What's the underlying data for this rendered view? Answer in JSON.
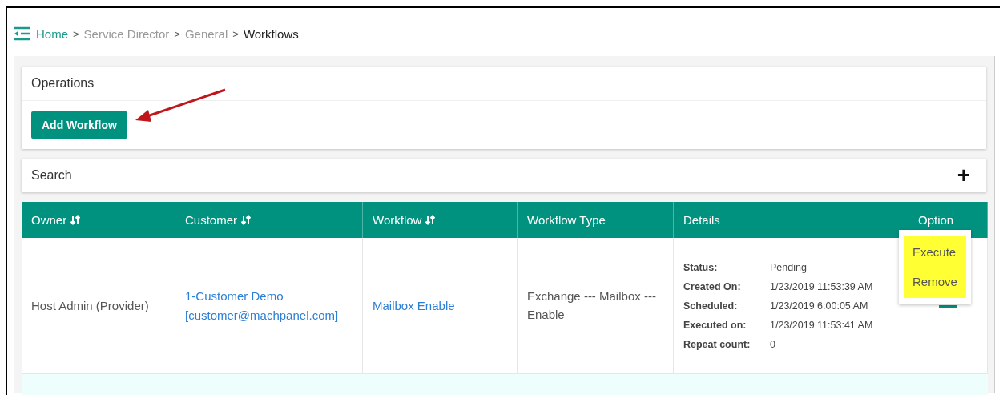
{
  "breadcrumb": [
    {
      "label": "Home",
      "kind": "link"
    },
    {
      "label": "Service Director",
      "kind": "muted"
    },
    {
      "label": "General",
      "kind": "muted"
    },
    {
      "label": "Workflows",
      "kind": "current"
    }
  ],
  "breadcrumb_separator": ">",
  "operations": {
    "title": "Operations",
    "button": "Add Workflow"
  },
  "search": {
    "title": "Search",
    "toggle": "+"
  },
  "table": {
    "columns": [
      {
        "label": "Owner",
        "sortable": true
      },
      {
        "label": "Customer",
        "sortable": true
      },
      {
        "label": "Workflow",
        "sortable": true
      },
      {
        "label": "Workflow Type",
        "sortable": false
      },
      {
        "label": "Details",
        "sortable": false
      },
      {
        "label": "Option",
        "sortable": false
      }
    ],
    "rows": [
      {
        "owner": "Host Admin (Provider)",
        "customer": [
          "1-Customer Demo",
          "[customer@machpanel.com]"
        ],
        "workflow": "Mailbox Enable",
        "workflow_type": "Exchange --- Mailbox --- Enable",
        "details": [
          {
            "label": "Status:",
            "value": "Pending"
          },
          {
            "label": "Created On:",
            "value": "1/23/2019 11:53:39 AM"
          },
          {
            "label": "Scheduled:",
            "value": "1/23/2019 6:00:05 AM"
          },
          {
            "label": "Executed on:",
            "value": "1/23/2019 11:53:41 AM"
          },
          {
            "label": "Repeat count:",
            "value": "0"
          }
        ]
      }
    ]
  },
  "option_menu": [
    "Execute",
    "Remove"
  ]
}
